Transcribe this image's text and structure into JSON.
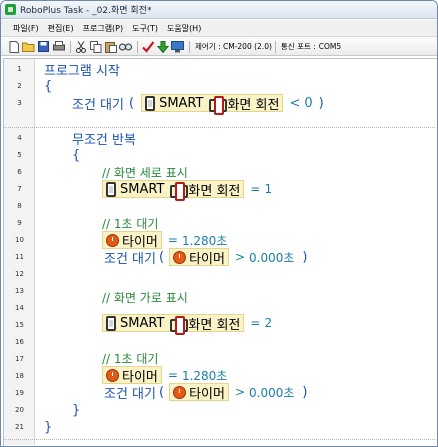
{
  "window": {
    "title": "RoboPlus Task - _02.화면 회전*"
  },
  "menu": [
    "파일(F)",
    "편집(E)",
    "프로그램(P)",
    "도구(T)",
    "도움말(H)"
  ],
  "toolbar": {
    "controller_label": "제어기 : CM-200 (2.0)",
    "port_label": "통신 포트 :",
    "port_value": "COM5"
  },
  "line_numbers": [
    "1",
    "2",
    "3",
    "4",
    "5",
    "6",
    "7",
    "8",
    "9",
    "10",
    "11",
    "12",
    "13",
    "14",
    "15",
    "16",
    "17",
    "18",
    "19",
    "20",
    "21"
  ],
  "code": {
    "program_start": "프로그램 시작",
    "open_brace": "{",
    "close_brace": "}",
    "wait_until": "조건 대기",
    "paren_open": "(",
    "paren_close": ")",
    "smart": "SMART",
    "screen_rotation": "화면 회전",
    "less_than": "<",
    "greater_than": ">",
    "equals": "=",
    "zero": "0",
    "endless_loop": "무조건 반복",
    "comment_portrait": "// 화면 세로 표시",
    "comment_landscape": "// 화면 가로 표시",
    "comment_wait1": "// 1초 대기",
    "value_one": "1",
    "value_two": "2",
    "timer": "타이머",
    "timer_value": "1.280초",
    "zero_sec": "0.000초"
  }
}
